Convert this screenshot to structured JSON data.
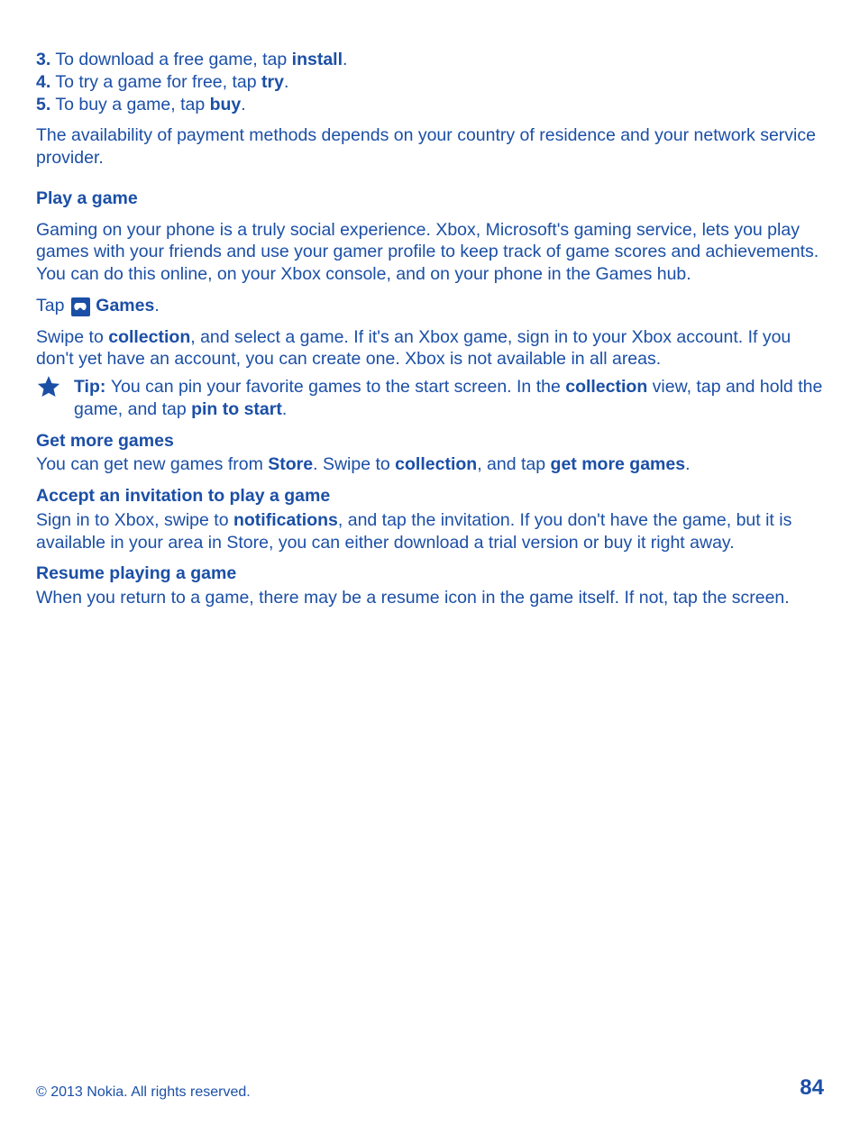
{
  "steps": [
    {
      "num": "3.",
      "text_before": " To download a free game, tap ",
      "bold": "install",
      "text_after": "."
    },
    {
      "num": "4.",
      "text_before": " To try a game for free, tap ",
      "bold": "try",
      "text_after": "."
    },
    {
      "num": "5.",
      "text_before": " To buy a game, tap ",
      "bold": "buy",
      "text_after": "."
    }
  ],
  "availability": "The availability of payment methods depends on your country of residence and your network service provider.",
  "play_heading": "Play a game",
  "play_intro": "Gaming on your phone is a truly social experience. Xbox, Microsoft's gaming service, lets you play games with your friends and use your gamer profile to keep track of game scores and achievements. You can do this online, on your Xbox console, and on your phone in the Games hub.",
  "tap_prefix": "Tap ",
  "tap_bold": "Games",
  "tap_suffix": ".",
  "swipe": {
    "a": "Swipe to ",
    "b_bold": "collection",
    "c": ", and select a game. If it's an Xbox game, sign in to your Xbox account. If you don't yet have an account, you can create one. Xbox is not available in all areas."
  },
  "tip": {
    "label": "Tip: ",
    "a": "You can pin your favorite games to the start screen. In the ",
    "b_bold": "collection",
    "c": " view, tap and hold the game, and tap ",
    "d_bold": "pin to start",
    "e": "."
  },
  "get_more": {
    "title": "Get more games",
    "a": "You can get new games from ",
    "b_bold": "Store",
    "c": ". Swipe to ",
    "d_bold": "collection",
    "e": ", and tap ",
    "f_bold": "get more games",
    "g": "."
  },
  "accept": {
    "title": "Accept an invitation to play a game",
    "a": "Sign in to Xbox, swipe to ",
    "b_bold": "notifications",
    "c": ", and tap the invitation. If you don't have the game, but it is available in your area in Store, you can either download a trial version or buy it right away."
  },
  "resume": {
    "title": "Resume playing a game",
    "text": "When you return to a game, there may be a resume icon in the game itself. If not, tap the screen."
  },
  "footer": {
    "copyright": "© 2013 Nokia. All rights reserved.",
    "page": "84"
  }
}
